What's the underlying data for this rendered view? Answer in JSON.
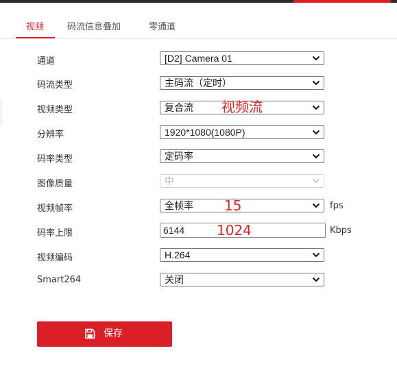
{
  "tabs": [
    {
      "label": "视频",
      "active": true
    },
    {
      "label": "码流信息叠加",
      "active": false
    },
    {
      "label": "零通道",
      "active": false
    }
  ],
  "form": {
    "channel": {
      "label": "通道",
      "value": "[D2] Camera 01"
    },
    "stream_type": {
      "label": "码流类型",
      "value": "主码流（定时）"
    },
    "video_type": {
      "label": "视频类型",
      "value": "复合流"
    },
    "resolution": {
      "label": "分辨率",
      "value": "1920*1080(1080P)"
    },
    "bitrate_type": {
      "label": "码率类型",
      "value": "定码率"
    },
    "image_quality": {
      "label": "图像质量",
      "value": "中",
      "disabled": true
    },
    "frame_rate": {
      "label": "视频帧率",
      "value": "全帧率",
      "unit": "fps"
    },
    "bitrate_limit": {
      "label": "码率上限",
      "value": "6144",
      "unit": "Kbps"
    },
    "video_encoding": {
      "label": "视频编码",
      "value": "H.264"
    },
    "smart264": {
      "label": "Smart264",
      "value": "关闭"
    }
  },
  "annotations": {
    "video_type": "视频流",
    "frame_rate": "15",
    "bitrate_limit": "1024"
  },
  "save_button": {
    "label": "保存",
    "icon": "save-icon"
  },
  "colors": {
    "accent": "#da1f26",
    "annotation": "#e02424",
    "topbar": "#2b2b2b"
  }
}
